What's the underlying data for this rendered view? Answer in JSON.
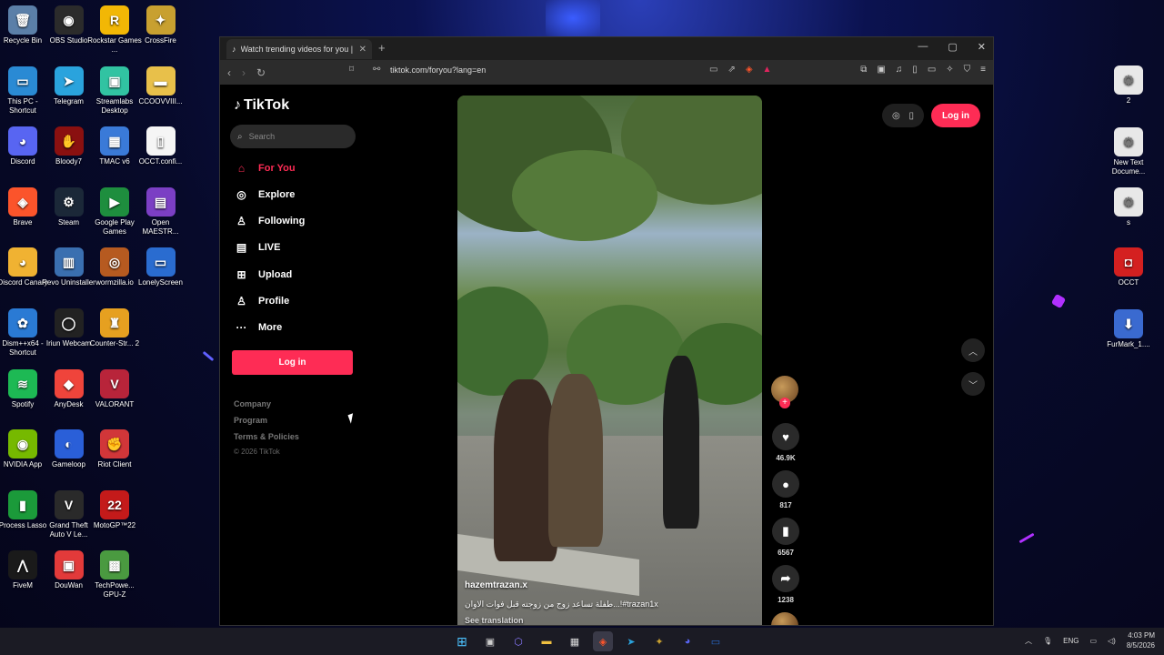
{
  "desktop": {
    "icons_left": [
      {
        "label": "Recycle Bin",
        "icon": "recycle-bin-icon",
        "color": "#5b7fa8",
        "glyph": "🗑"
      },
      {
        "label": "OBS Studio",
        "icon": "obs-icon",
        "color": "#2b2b2b",
        "glyph": "◉"
      },
      {
        "label": "Rockstar Games ...",
        "icon": "rockstar-icon",
        "color": "#f2b705",
        "glyph": "R"
      },
      {
        "label": "CrossFire",
        "icon": "crossfire-icon",
        "color": "#c8a030",
        "glyph": "✦"
      },
      {
        "label": "This PC - Shortcut",
        "icon": "pc-icon",
        "color": "#2a8ad4",
        "glyph": "▭"
      },
      {
        "label": "Telegram",
        "icon": "telegram-icon",
        "color": "#2aa3dd",
        "glyph": "➤"
      },
      {
        "label": "Streamlabs Desktop",
        "icon": "streamlabs-icon",
        "color": "#31c3a2",
        "glyph": "▣"
      },
      {
        "label": "CCOOVVIII...",
        "icon": "folder-icon",
        "color": "#e8c04a",
        "glyph": "▬"
      },
      {
        "label": "Discord",
        "icon": "discord-icon",
        "color": "#5865f2",
        "glyph": "◕"
      },
      {
        "label": "Bloody7",
        "icon": "bloody-icon",
        "color": "#8a1010",
        "glyph": "✋"
      },
      {
        "label": "TMAC v6",
        "icon": "tmac-icon",
        "color": "#3a7ad8",
        "glyph": "▦"
      },
      {
        "label": "OCCT.confi...",
        "icon": "file-icon",
        "color": "#f5f5f5",
        "glyph": "▯"
      },
      {
        "label": "Brave",
        "icon": "brave-icon",
        "color": "#fb542b",
        "glyph": "◈"
      },
      {
        "label": "Steam",
        "icon": "steam-icon",
        "color": "#1b2838",
        "glyph": "⚙"
      },
      {
        "label": "Google Play Games",
        "icon": "google-play-icon",
        "color": "#1e8e3e",
        "glyph": "▶"
      },
      {
        "label": "Open MAESTR...",
        "icon": "maestro-icon",
        "color": "#7b3fc4",
        "glyph": "▤"
      },
      {
        "label": "Discord Canary",
        "icon": "discord-canary-icon",
        "color": "#f0b232",
        "glyph": "◕"
      },
      {
        "label": "Revo Uninstaller",
        "icon": "revo-icon",
        "color": "#3a6fb0",
        "glyph": "▥"
      },
      {
        "label": "wormzilla.io",
        "icon": "wormzilla-icon",
        "color": "#b65a20",
        "glyph": "◎"
      },
      {
        "label": "LonelyScreen",
        "icon": "lonelyscreen-icon",
        "color": "#2a6cd0",
        "glyph": "▭"
      },
      {
        "label": "Dism++x64 - Shortcut",
        "icon": "dism-icon",
        "color": "#2a7ad4",
        "glyph": "✿"
      },
      {
        "label": "Iriun Webcam",
        "icon": "iriun-icon",
        "color": "#222",
        "glyph": "◯"
      },
      {
        "label": "Counter-Str... 2",
        "icon": "cs2-icon",
        "color": "#e6a020",
        "glyph": "♜"
      },
      {
        "label": "",
        "icon": "blank-icon",
        "color": "transparent",
        "glyph": ""
      },
      {
        "label": "Spotify",
        "icon": "spotify-icon",
        "color": "#1db954",
        "glyph": "≋"
      },
      {
        "label": "AnyDesk",
        "icon": "anydesk-icon",
        "color": "#ef443b",
        "glyph": "◆"
      },
      {
        "label": "VALORANT",
        "icon": "valorant-icon",
        "color": "#b8243a",
        "glyph": "V"
      },
      {
        "label": "",
        "icon": "blank-icon",
        "color": "transparent",
        "glyph": ""
      },
      {
        "label": "NVIDIA App",
        "icon": "nvidia-icon",
        "color": "#76b900",
        "glyph": "◉"
      },
      {
        "label": "Gameloop",
        "icon": "gameloop-icon",
        "color": "#2a5fd8",
        "glyph": "◐"
      },
      {
        "label": "Riot Client",
        "icon": "riot-icon",
        "color": "#d13639",
        "glyph": "✊"
      },
      {
        "label": "",
        "icon": "blank-icon",
        "color": "transparent",
        "glyph": ""
      },
      {
        "label": "Process Lasso",
        "icon": "process-lasso-icon",
        "color": "#1b9a3a",
        "glyph": "▮"
      },
      {
        "label": "Grand Theft Auto V Le...",
        "icon": "gta-icon",
        "color": "#2a2a2a",
        "glyph": "V"
      },
      {
        "label": "MotoGP™22",
        "icon": "motogp-icon",
        "color": "#c41a1a",
        "glyph": "22"
      },
      {
        "label": "",
        "icon": "blank-icon",
        "color": "transparent",
        "glyph": ""
      },
      {
        "label": "FiveM",
        "icon": "fivem-icon",
        "color": "#1a1a1a",
        "glyph": "⋀"
      },
      {
        "label": "DouWan",
        "icon": "douwan-icon",
        "color": "#e23a3a",
        "glyph": "▣"
      },
      {
        "label": "TechPowe... GPU-Z",
        "icon": "gpuz-icon",
        "color": "#4a9a40",
        "glyph": "▩"
      }
    ],
    "icons_right": [
      {
        "label": "2",
        "icon": "settings-file-icon",
        "color": "#e8e8e8",
        "glyph": "⚙"
      },
      {
        "label": "New Text Docume...",
        "icon": "settings-file-icon",
        "color": "#e8e8e8",
        "glyph": "⚙"
      },
      {
        "label": "s",
        "icon": "settings-file-icon",
        "color": "#e8e8e8",
        "glyph": "⚙"
      },
      {
        "label": "OCCT",
        "icon": "occt-icon",
        "color": "#d42020",
        "glyph": "◘"
      },
      {
        "label": "FurMark_1....",
        "icon": "furmark-icon",
        "color": "#3a6ad0",
        "glyph": "⬇"
      }
    ]
  },
  "browser": {
    "tab_title": "Watch trending videos for you |",
    "url": "tiktok.com/foryou?lang=en"
  },
  "tiktok": {
    "logo": "TikTok",
    "search_placeholder": "Search",
    "nav": [
      {
        "label": "For You",
        "icon": "home-icon",
        "glyph": "⌂",
        "active": true
      },
      {
        "label": "Explore",
        "icon": "compass-icon",
        "glyph": "◎",
        "active": false
      },
      {
        "label": "Following",
        "icon": "following-icon",
        "glyph": "♙",
        "active": false
      },
      {
        "label": "LIVE",
        "icon": "live-icon",
        "glyph": "▤",
        "active": false
      },
      {
        "label": "Upload",
        "icon": "upload-icon",
        "glyph": "⊞",
        "active": false
      },
      {
        "label": "Profile",
        "icon": "profile-icon",
        "glyph": "♙",
        "active": false
      },
      {
        "label": "More",
        "icon": "more-icon",
        "glyph": "···",
        "active": false
      }
    ],
    "login_label": "Log in",
    "footer_links": [
      "Company",
      "Program",
      "Terms & Policies"
    ],
    "copyright": "© 2026 TikTok",
    "video": {
      "username": "hazemtrazan.x",
      "caption": "طفلة تساعد زوج من زوجته قبل فوات الاوان...!#trazan1x",
      "see_translation": "See translation"
    },
    "actions": {
      "likes": "46.9K",
      "comments": "817",
      "saves": "6567",
      "shares": "1238"
    },
    "top_login": "Log in",
    "accent": "#fe2c55"
  },
  "taskbar": {
    "lang": "ENG",
    "time": "4:03 PM",
    "date": "8/5/2026"
  }
}
